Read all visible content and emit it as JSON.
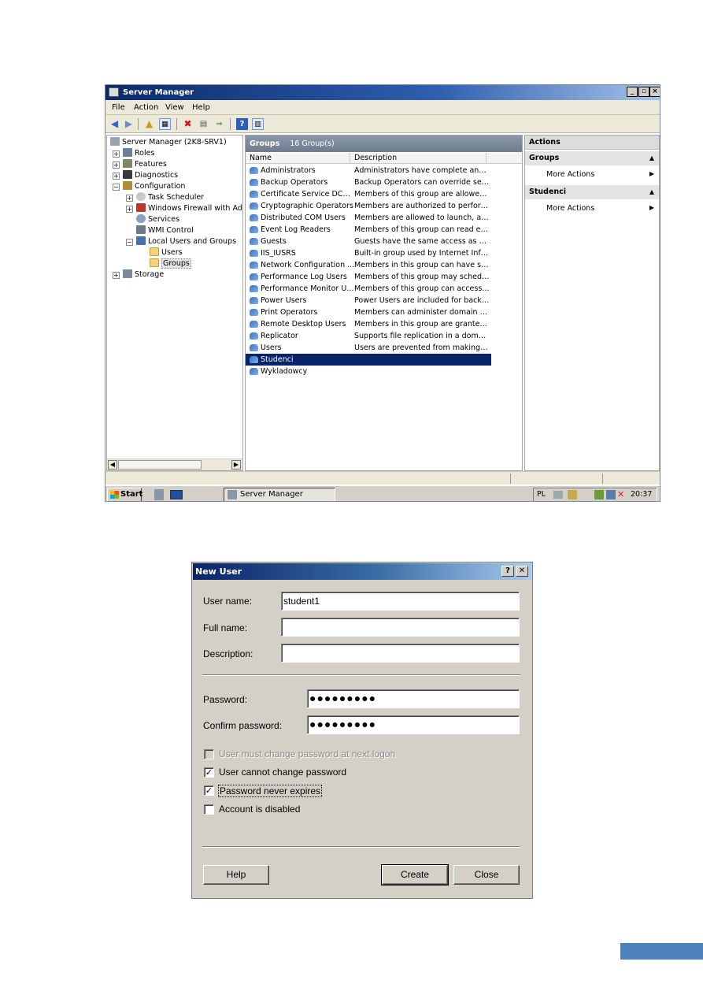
{
  "server_manager": {
    "title": "Server Manager",
    "menu": [
      "File",
      "Action",
      "View",
      "Help"
    ],
    "tree": [
      {
        "label": "Server Manager (2K8-SRV1)",
        "level": 0,
        "expander": ""
      },
      {
        "label": "Roles",
        "level": 1,
        "expander": "+"
      },
      {
        "label": "Features",
        "level": 1,
        "expander": "+"
      },
      {
        "label": "Diagnostics",
        "level": 1,
        "expander": "+"
      },
      {
        "label": "Configuration",
        "level": 1,
        "expander": "−"
      },
      {
        "label": "Task Scheduler",
        "level": 2,
        "expander": "+"
      },
      {
        "label": "Windows Firewall with Adva",
        "level": 2,
        "expander": "+"
      },
      {
        "label": "Services",
        "level": 2,
        "expander": ""
      },
      {
        "label": "WMI Control",
        "level": 2,
        "expander": ""
      },
      {
        "label": "Local Users and Groups",
        "level": 2,
        "expander": "−"
      },
      {
        "label": "Users",
        "level": 3,
        "expander": ""
      },
      {
        "label": "Groups",
        "level": 3,
        "expander": "",
        "selected": true
      },
      {
        "label": "Storage",
        "level": 1,
        "expander": "+"
      }
    ],
    "center": {
      "heading": "Groups",
      "count": "16 Group(s)",
      "columns": [
        "Name",
        "Description"
      ],
      "rows": [
        {
          "name": "Administrators",
          "desc": "Administrators have complete and u..."
        },
        {
          "name": "Backup Operators",
          "desc": "Backup Operators can override secu..."
        },
        {
          "name": "Certificate Service DCO...",
          "desc": "Members of this group are allowed t..."
        },
        {
          "name": "Cryptographic Operators",
          "desc": "Members are authorized to perform ..."
        },
        {
          "name": "Distributed COM Users",
          "desc": "Members are allowed to launch, acti..."
        },
        {
          "name": "Event Log Readers",
          "desc": "Members of this group can read eve..."
        },
        {
          "name": "Guests",
          "desc": "Guests have the same access as me..."
        },
        {
          "name": "IIS_IUSRS",
          "desc": "Built-in group used by Internet Infor..."
        },
        {
          "name": "Network Configuration ...",
          "desc": "Members in this group can have som..."
        },
        {
          "name": "Performance Log Users",
          "desc": "Members of this group may schedule..."
        },
        {
          "name": "Performance Monitor U...",
          "desc": "Members of this group can access p..."
        },
        {
          "name": "Power Users",
          "desc": "Power Users are included for backw..."
        },
        {
          "name": "Print Operators",
          "desc": "Members can administer domain prin..."
        },
        {
          "name": "Remote Desktop Users",
          "desc": "Members in this group are granted t..."
        },
        {
          "name": "Replicator",
          "desc": "Supports file replication in a domain"
        },
        {
          "name": "Users",
          "desc": "Users are prevented from making ac..."
        },
        {
          "name": "Studenci",
          "desc": "",
          "selected": true
        },
        {
          "name": "Wykladowcy",
          "desc": ""
        }
      ]
    },
    "actions": {
      "title": "Actions",
      "sections": [
        {
          "heading": "Groups",
          "link": "More Actions"
        },
        {
          "heading": "Studenci",
          "link": "More Actions"
        }
      ]
    },
    "taskbar": {
      "start": "Start",
      "app": "Server Manager",
      "lang": "PL",
      "clock": "20:37"
    }
  },
  "new_user": {
    "title": "New User",
    "user_name_label": "User name:",
    "user_name_value": "student1",
    "full_name_label": "Full name:",
    "full_name_value": "",
    "description_label": "Description:",
    "description_value": "",
    "password_label": "Password:",
    "password_value": "●●●●●●●●●",
    "confirm_label": "Confirm password:",
    "confirm_value": "●●●●●●●●●",
    "checkboxes": [
      {
        "label": "User must change password at next logon",
        "checked": false,
        "disabled": true
      },
      {
        "label": "User cannot change password",
        "checked": true,
        "disabled": false
      },
      {
        "label": "Password never expires",
        "checked": true,
        "disabled": false
      },
      {
        "label": "Account is disabled",
        "checked": false,
        "disabled": false
      }
    ],
    "buttons": {
      "help": "Help",
      "create": "Create",
      "close": "Close"
    }
  },
  "colors": {
    "selection": "#0a246a",
    "accent_bar": "#4f81bd"
  }
}
